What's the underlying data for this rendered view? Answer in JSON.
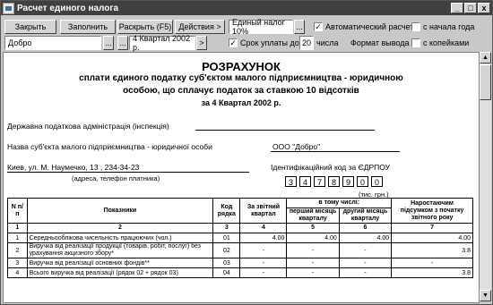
{
  "window": {
    "title": "Расчет единого налога",
    "title_buttons": [
      "_",
      "□",
      "x"
    ]
  },
  "toolbar": {
    "close_label": "Закрыть",
    "fill_label": "Заполнить",
    "expand_label": "Раскрыть (F5)",
    "actions_label": "Действия >",
    "tax_select": "Единый налог 10%",
    "tax_select_btn": "...",
    "auto_calc_label": "Автоматический расчет",
    "auto_calc_checked": "✓",
    "year_start_label": "с начала года",
    "org_value": "Добро",
    "org_btn": "...",
    "period_btn": "...",
    "period_value": "4 Квартал 2002 р.",
    "period_next": ">",
    "due_label": "Срок уплаты до",
    "due_checked": "✓",
    "due_value": "20",
    "due_suffix": "числа",
    "output_format_label": "Формат вывода :",
    "kopecks_label": "с копейками"
  },
  "document": {
    "title": "РОЗРАХУНОК",
    "subtitle_1": "сплати єдиного податку суб'єктом малого підприємництва - юридичною",
    "subtitle_2": "особою, що сплачує податок за ставкою 10 відсотків",
    "subtitle_3": "за 4 Квартал 2002 р.",
    "tax_office_label": "Державна податкова адміністрація (інспекція)",
    "entity_label": "Назва суб'єкта малого підприємництва - юридичної особи",
    "entity_value": "ООО \"Добро\"",
    "address_value": "Киев, ул. М. Наумечко, 13 , 234-34-23",
    "address_caption": "(адреса, телефон платника)",
    "code_label": "Ідентифікаційний код за ЄДРПОУ",
    "code_digits": [
      "3",
      "4",
      "7",
      "8",
      "9",
      "0",
      "0"
    ],
    "units": "(тис. грн.)"
  },
  "table": {
    "headers": {
      "num": "N п/п",
      "indicator": "Показники",
      "code": "Код рядка",
      "report_q": "За звітний квартал",
      "incl": "в тому числі:",
      "first_m": "перший місяць кварталу",
      "second_m": "другий місяць кварталу",
      "cumulative": "Наростаючим підсумком з початку звітного року"
    },
    "col_numbers": [
      "1",
      "2",
      "3",
      "4",
      "5",
      "6",
      "7"
    ],
    "rows": [
      {
        "n": "1",
        "name": "Середньооблікова чисельність працюючих (чол.)",
        "code": "01",
        "q": "4.00",
        "m1": "4.00",
        "m2": "4.00",
        "cum": "4.00"
      },
      {
        "n": "2",
        "name": "Виручка від реалізації продукції (товарів, робіт, послуг) без урахування акцизного збору*",
        "code": "02",
        "q": "-",
        "m1": "-",
        "m2": "-",
        "cum": "3.8"
      },
      {
        "n": "3",
        "name": "Виручка від реалізації основних фондів**",
        "code": "03",
        "q": "-",
        "m1": "-",
        "m2": "-",
        "cum": "-"
      },
      {
        "n": "4",
        "name": "Всього виручка від реалізації (рядок 02 + рядок 03)",
        "code": "04",
        "q": "-",
        "m1": "-",
        "m2": "-",
        "cum": "3.8"
      }
    ]
  }
}
